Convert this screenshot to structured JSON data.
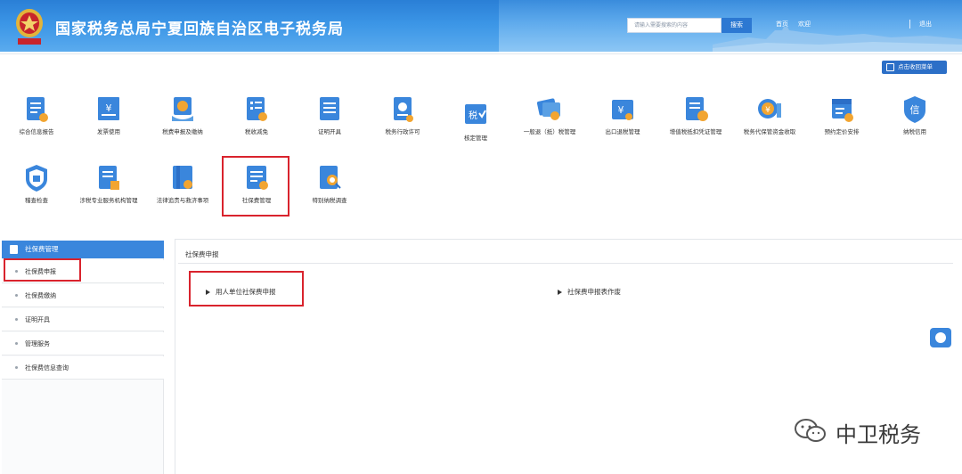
{
  "header": {
    "site_title": "国家税务总局宁夏回族自治区电子税务局",
    "search_placeholder": "请输入需要搜索的内容",
    "search_button": "搜索",
    "link_home": "首页",
    "link_welcome": "欢迎",
    "link_logout": "退出"
  },
  "toolbar": {
    "collapse_menu": "点击收回菜单"
  },
  "functions_row1": [
    {
      "label": "综合信息报告",
      "icon": "report-icon"
    },
    {
      "label": "发票使用",
      "icon": "invoice-icon"
    },
    {
      "label": "税费申报及缴纳",
      "icon": "declare-pay-icon"
    },
    {
      "label": "税收减免",
      "icon": "tax-relief-icon"
    },
    {
      "label": "证明开具",
      "icon": "certificate-icon"
    },
    {
      "label": "税务行政许可",
      "icon": "license-icon"
    },
    {
      "label": "核定管理",
      "icon": "assessment-icon"
    },
    {
      "label": "一般退（抵）税管理",
      "icon": "refund-icon"
    },
    {
      "label": "出口退税管理",
      "icon": "export-refund-icon"
    },
    {
      "label": "增值税抵扣凭证管理",
      "icon": "vat-voucher-icon"
    },
    {
      "label": "税务代保管资金收取",
      "icon": "custody-fund-icon"
    },
    {
      "label": "预约定价安排",
      "icon": "pricing-icon"
    },
    {
      "label": "纳税信用",
      "icon": "credit-icon"
    }
  ],
  "functions_row2": [
    {
      "label": "稽查检查",
      "icon": "inspection-icon"
    },
    {
      "label": "涉税专业服务机构管理",
      "icon": "agency-icon"
    },
    {
      "label": "法律追责与救济事项",
      "icon": "legal-icon"
    },
    {
      "label": "社保费管理",
      "icon": "social-insurance-icon"
    },
    {
      "label": "特别纳税调查",
      "icon": "special-investigation-icon"
    }
  ],
  "sidebar": {
    "title": "社保费管理",
    "items": [
      {
        "label": "社保费申报"
      },
      {
        "label": "社保费缴纳"
      },
      {
        "label": "证明开具"
      },
      {
        "label": "管理服务"
      },
      {
        "label": "社保费信息查询"
      }
    ]
  },
  "main": {
    "panel_title": "社保费申报",
    "links": [
      {
        "label": "用人单位社保费申报"
      },
      {
        "label": "社保费申报表作废"
      }
    ]
  },
  "watermark": {
    "text": "中卫税务"
  },
  "colors": {
    "header_blue": "#2a7fd6",
    "accent_blue": "#3a86dc",
    "highlight_red": "#d9232d"
  }
}
